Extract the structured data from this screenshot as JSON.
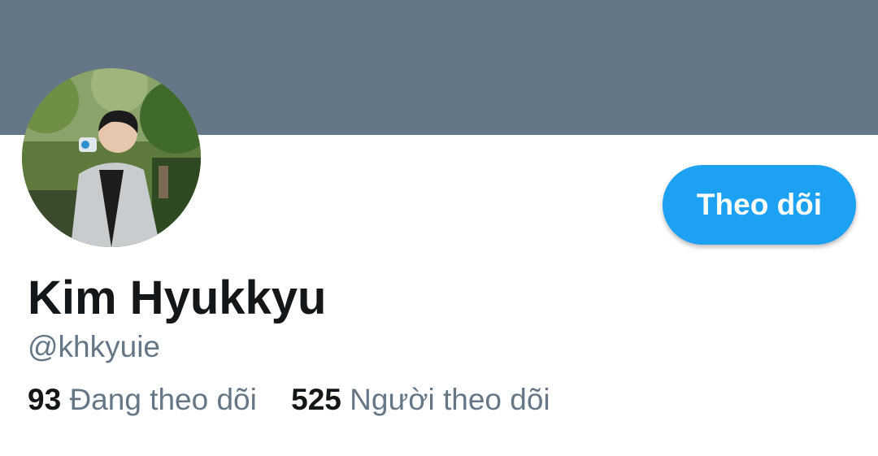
{
  "profile": {
    "display_name": "Kim Hyukkyu",
    "handle": "@khkyuie",
    "following_count": "93",
    "following_label": "Đang theo dõi",
    "followers_count": "525",
    "followers_label": "Người theo dõi"
  },
  "actions": {
    "follow_label": "Theo dõi"
  },
  "colors": {
    "banner": "#657786",
    "accent": "#1da1f2",
    "primary_text": "#14171a",
    "secondary_text": "#657786"
  }
}
